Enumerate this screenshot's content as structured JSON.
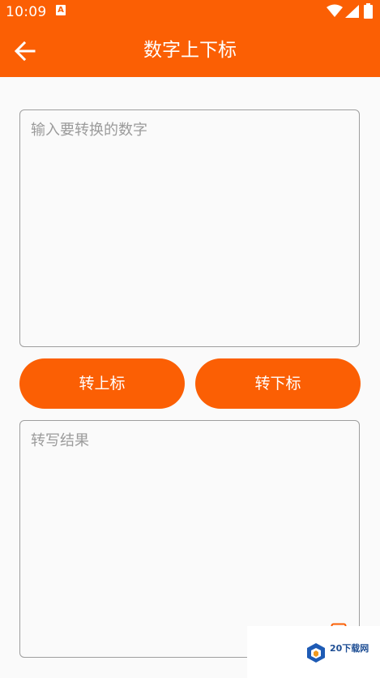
{
  "status_bar": {
    "time": "10:09",
    "notification_badge": "A"
  },
  "app_bar": {
    "title": "数字上下标"
  },
  "input": {
    "placeholder": "输入要转换的数字",
    "value": ""
  },
  "actions": {
    "superscript_label": "转上标",
    "subscript_label": "转下标"
  },
  "result": {
    "placeholder": "转写结果",
    "value": ""
  },
  "watermark": {
    "text": "20下载网"
  },
  "colors": {
    "accent": "#fb5f04",
    "background": "#fafafa",
    "border": "#9e9e9e"
  },
  "icons": [
    "back-arrow-icon",
    "wifi-icon",
    "signal-icon",
    "battery-icon",
    "copy-icon",
    "logo-icon"
  ]
}
